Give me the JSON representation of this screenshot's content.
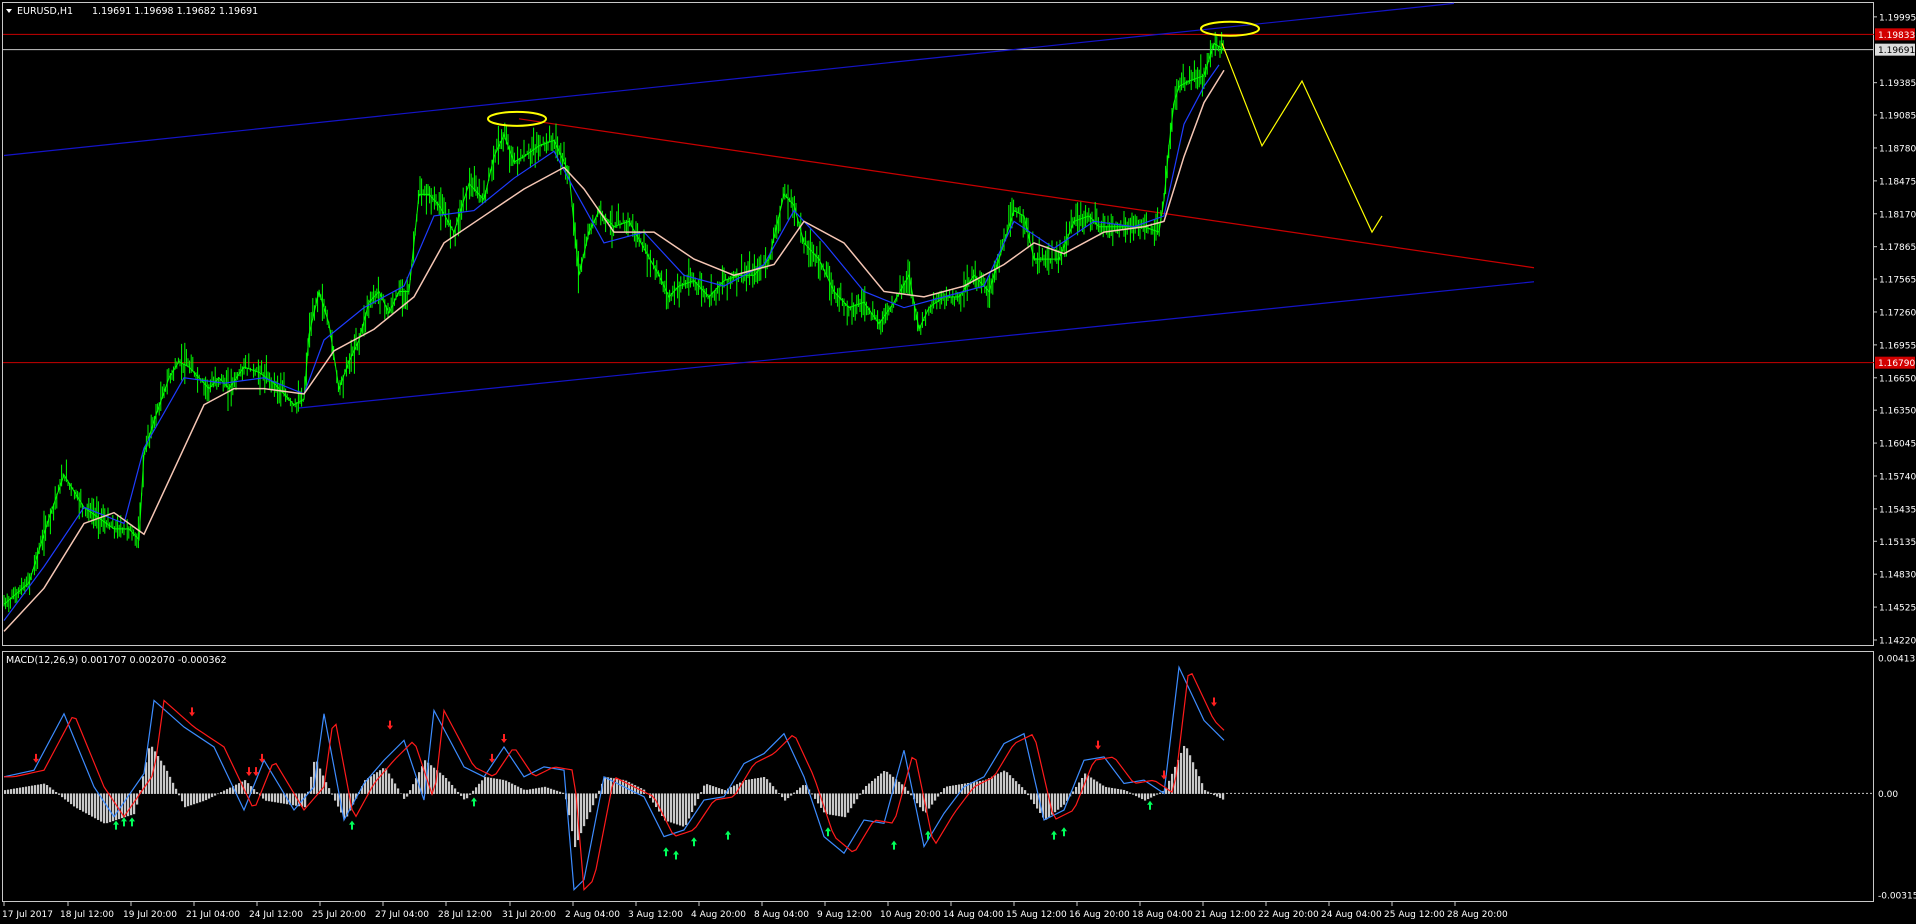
{
  "window": {
    "symbol_label": "EURUSD,H1",
    "ohlc_label": "1.19691 1.19698 1.19682 1.19691",
    "menu_icon": "triangle-down-icon"
  },
  "indicator": {
    "label": "MACD(12,26,9) 0.001707 0.002070 -0.000362"
  },
  "colors": {
    "background": "#000000",
    "frame": "#c8c8c8",
    "candles": "#00ff00",
    "ema_fast": "#1e3cff",
    "ema_slow": "#f5c6b4",
    "channel": "#1414c8",
    "resistance": "#c80000",
    "projection": "#ffff00",
    "macd_hist": "#c8c8c8",
    "macd_line": "#3c8cff",
    "signal_line": "#ff1a1a",
    "arrow_up": "#00ff5a",
    "arrow_down": "#ff2020",
    "price_tag_red": "#d20000"
  },
  "chart_data": {
    "type": "line",
    "title": "",
    "symbol": "EURUSD",
    "timeframe": "H1",
    "y_ticks": [
      "1.19995",
      "1.19385",
      "1.19085",
      "1.18780",
      "1.18475",
      "1.18170",
      "1.17865",
      "1.17565",
      "1.17260",
      "1.16955",
      "1.16650",
      "1.16350",
      "1.16045",
      "1.15740",
      "1.15435",
      "1.15135",
      "1.14830",
      "1.14525",
      "1.14220"
    ],
    "ylim": [
      1.1422,
      1.2004
    ],
    "x_labels": [
      "17 Jul 2017",
      "18 Jul 12:00",
      "19 Jul 20:00",
      "21 Jul 04:00",
      "24 Jul 12:00",
      "25 Jul 20:00",
      "27 Jul 04:00",
      "28 Jul 12:00",
      "31 Jul 20:00",
      "2 Aug 04:00",
      "3 Aug 12:00",
      "4 Aug 20:00",
      "8 Aug 04:00",
      "9 Aug 12:00",
      "10 Aug 20:00",
      "14 Aug 04:00",
      "15 Aug 12:00",
      "16 Aug 20:00",
      "18 Aug 04:00",
      "21 Aug 12:00",
      "22 Aug 20:00",
      "24 Aug 04:00",
      "25 Aug 12:00",
      "28 Aug 20:00"
    ],
    "series": [
      {
        "role": "price",
        "x": [
          0,
          25,
          45,
          60,
          80,
          95,
          110,
          125,
          135,
          140,
          150,
          165,
          175,
          185,
          195,
          205,
          215,
          225,
          240,
          255,
          270,
          290,
          300,
          305,
          315,
          325,
          335,
          345,
          355,
          365,
          375,
          385,
          395,
          405,
          415,
          425,
          435,
          450,
          465,
          480,
          490,
          500,
          510,
          520,
          535,
          550,
          565,
          575,
          585,
          595,
          610,
          625,
          640,
          655,
          665,
          675,
          690,
          705,
          720,
          735,
          750,
          765,
          780,
          790,
          800,
          815,
          830,
          845,
          860,
          875,
          890,
          905,
          915,
          925,
          940,
          955,
          970,
          985,
          1000,
          1010,
          1020,
          1030,
          1040,
          1055,
          1070,
          1085,
          1095,
          1110,
          1125,
          1140,
          1155,
          1160,
          1165,
          1170,
          1175,
          1185,
          1200,
          1210,
          1220
        ],
        "y": [
          1.1455,
          1.1475,
          1.1535,
          1.1575,
          1.1545,
          1.1535,
          1.1525,
          1.1525,
          1.1515,
          1.1595,
          1.1625,
          1.1665,
          1.168,
          1.1675,
          1.1665,
          1.1655,
          1.1665,
          1.1655,
          1.1675,
          1.167,
          1.166,
          1.164,
          1.1645,
          1.1705,
          1.1745,
          1.1715,
          1.1655,
          1.168,
          1.17,
          1.1735,
          1.1745,
          1.1725,
          1.1745,
          1.1745,
          1.1835,
          1.1835,
          1.1825,
          1.18,
          1.1845,
          1.183,
          1.187,
          1.189,
          1.1865,
          1.187,
          1.188,
          1.1885,
          1.1855,
          1.176,
          1.18,
          1.182,
          1.1805,
          1.181,
          1.1785,
          1.176,
          1.174,
          1.175,
          1.1755,
          1.174,
          1.1755,
          1.176,
          1.176,
          1.1775,
          1.1835,
          1.1825,
          1.179,
          1.1775,
          1.1745,
          1.173,
          1.1735,
          1.1715,
          1.1735,
          1.176,
          1.171,
          1.173,
          1.174,
          1.174,
          1.176,
          1.1745,
          1.179,
          1.182,
          1.1815,
          1.1775,
          1.1775,
          1.1775,
          1.181,
          1.1815,
          1.1805,
          1.1805,
          1.1805,
          1.1805,
          1.18,
          1.183,
          1.188,
          1.192,
          1.1935,
          1.194,
          1.1945,
          1.1975,
          1.1969
        ]
      },
      {
        "role": "fast moving average",
        "x": [
          0,
          40,
          80,
          120,
          140,
          180,
          220,
          260,
          300,
          320,
          360,
          400,
          430,
          470,
          510,
          550,
          570,
          600,
          640,
          680,
          720,
          760,
          790,
          820,
          860,
          900,
          940,
          980,
          1010,
          1050,
          1090,
          1130,
          1160,
          1180,
          1200,
          1215
        ],
        "y": [
          1.144,
          1.149,
          1.1545,
          1.153,
          1.16,
          1.1665,
          1.166,
          1.1665,
          1.165,
          1.17,
          1.173,
          1.175,
          1.1815,
          1.182,
          1.185,
          1.1875,
          1.184,
          1.179,
          1.18,
          1.176,
          1.175,
          1.177,
          1.182,
          1.179,
          1.1745,
          1.173,
          1.174,
          1.175,
          1.181,
          1.1785,
          1.181,
          1.1805,
          1.1815,
          1.19,
          1.1935,
          1.1955
        ]
      },
      {
        "role": "slow moving average",
        "x": [
          0,
          40,
          80,
          110,
          140,
          170,
          200,
          230,
          260,
          300,
          330,
          370,
          410,
          440,
          480,
          520,
          560,
          580,
          610,
          650,
          690,
          730,
          770,
          800,
          840,
          880,
          920,
          960,
          1000,
          1030,
          1060,
          1100,
          1140,
          1160,
          1180,
          1200,
          1220
        ],
        "y": [
          1.143,
          1.147,
          1.153,
          1.154,
          1.152,
          1.158,
          1.164,
          1.1655,
          1.1655,
          1.165,
          1.169,
          1.171,
          1.174,
          1.179,
          1.1815,
          1.184,
          1.186,
          1.184,
          1.18,
          1.18,
          1.1775,
          1.176,
          1.177,
          1.181,
          1.179,
          1.1745,
          1.174,
          1.175,
          1.177,
          1.179,
          1.178,
          1.18,
          1.1805,
          1.181,
          1.187,
          1.192,
          1.195
        ]
      }
    ],
    "horizontal_levels": [
      {
        "price": 1.19833,
        "label": "1.19833",
        "style": "red line + red tag"
      },
      {
        "price": 1.19691,
        "label": "1.19691",
        "style": "bid line + grey tag"
      },
      {
        "price": 1.1679,
        "label": "1.16790",
        "style": "red line + red tag"
      }
    ],
    "trendlines": [
      {
        "kind": "channel upper",
        "points": [
          [
            0,
            1.1871
          ],
          [
            1450,
            1.2012
          ]
        ]
      },
      {
        "kind": "channel lower",
        "points": [
          [
            295,
            1.1637
          ],
          [
            1530,
            1.1754
          ]
        ]
      },
      {
        "kind": "resistance",
        "points": [
          [
            515,
            1.1905
          ],
          [
            1530,
            1.1767
          ]
        ]
      }
    ],
    "highlights": [
      {
        "kind": "ellipse",
        "center": [
          513,
          1.1905
        ]
      },
      {
        "kind": "ellipse",
        "center": [
          1226,
          1.19885
        ]
      }
    ],
    "projection": {
      "x": [
        1218,
        1258,
        1298,
        1368,
        1378
      ],
      "y": [
        1.1975,
        1.188,
        1.194,
        1.18,
        1.1815
      ]
    },
    "macd": {
      "ylim": [
        -0.00315,
        0.00414
      ],
      "y_ticks": [
        "0.004137",
        "0.00",
        "-0.003151"
      ],
      "hist_x": [
        0,
        40,
        70,
        100,
        130,
        145,
        160,
        180,
        200,
        220,
        240,
        260,
        280,
        300,
        310,
        320,
        340,
        360,
        380,
        400,
        420,
        440,
        460,
        480,
        500,
        520,
        540,
        560,
        570,
        580,
        600,
        620,
        640,
        660,
        680,
        700,
        720,
        740,
        760,
        780,
        800,
        820,
        840,
        860,
        880,
        900,
        920,
        940,
        960,
        980,
        1000,
        1020,
        1040,
        1060,
        1080,
        1100,
        1120,
        1140,
        1160,
        1180,
        1200,
        1220
      ],
      "hist_y": [
        0.0001,
        0.0003,
        -0.0004,
        -0.0009,
        -0.0006,
        0.0015,
        0.0008,
        -0.0004,
        -0.0002,
        0.0001,
        0.0004,
        -0.0002,
        -0.0003,
        -0.0004,
        0.0011,
        0.0004,
        -0.0008,
        0.0004,
        0.0008,
        -0.0002,
        0.001,
        0.0005,
        -0.0002,
        0.0005,
        0.0004,
        0.0001,
        0.0002,
        0.0,
        -0.0016,
        -0.0009,
        0.0005,
        0.0004,
        0.0001,
        -0.0008,
        -0.001,
        0.0003,
        0.0001,
        0.0004,
        0.0005,
        -0.0002,
        0.0003,
        -0.0006,
        -0.0007,
        0.0002,
        0.0007,
        0.0002,
        -0.0006,
        0.0002,
        0.0003,
        0.0004,
        0.0007,
        0.0001,
        -0.0008,
        -0.0003,
        0.0006,
        0.0002,
        0.0001,
        -0.0002,
        0.0001,
        0.0015,
        0.0001,
        -0.0002
      ],
      "macd_x": [
        0,
        30,
        60,
        90,
        110,
        140,
        150,
        180,
        210,
        240,
        260,
        290,
        310,
        320,
        340,
        360,
        380,
        400,
        420,
        430,
        460,
        480,
        500,
        520,
        540,
        560,
        570,
        580,
        600,
        620,
        640,
        660,
        680,
        700,
        720,
        740,
        760,
        780,
        800,
        820,
        840,
        860,
        880,
        900,
        920,
        940,
        960,
        980,
        1000,
        1020,
        1040,
        1060,
        1080,
        1100,
        1120,
        1140,
        1160,
        1175,
        1200,
        1220
      ],
      "macd_y": [
        0.0005,
        0.0007,
        0.0024,
        0.0002,
        -0.0007,
        0.0006,
        0.0028,
        0.002,
        0.0014,
        -0.0005,
        0.001,
        -0.0005,
        0.0002,
        0.0024,
        -0.0008,
        0.0003,
        0.001,
        0.0016,
        -0.0002,
        0.0025,
        0.0008,
        0.0005,
        0.0014,
        0.0005,
        0.0008,
        0.0007,
        -0.0029,
        -0.0026,
        0.0005,
        0.0002,
        -0.0001,
        -0.0013,
        -0.0011,
        -0.0002,
        -0.0001,
        0.0009,
        0.0012,
        0.0018,
        0.0005,
        -0.0013,
        -0.0018,
        -0.0008,
        -0.0009,
        0.0013,
        -0.0016,
        -0.0006,
        0.0002,
        0.0005,
        0.0015,
        0.0018,
        -0.0008,
        -0.0005,
        0.001,
        0.0011,
        0.0003,
        0.0004,
        0.0,
        0.0038,
        0.0022,
        0.0016
      ]
    },
    "arrows_up": [
      [
        112,
        -0.0007
      ],
      [
        120,
        -0.0006
      ],
      [
        128,
        -0.0006
      ],
      [
        348,
        -0.0007
      ],
      [
        470,
        0.0
      ],
      [
        662,
        -0.0015
      ],
      [
        672,
        -0.0016
      ],
      [
        690,
        -0.0012
      ],
      [
        724,
        -0.001
      ],
      [
        824,
        -0.0009
      ],
      [
        890,
        -0.0013
      ],
      [
        924,
        -0.001
      ],
      [
        1050,
        -0.001
      ],
      [
        1060,
        -0.0009
      ],
      [
        1146,
        -0.0001
      ]
    ],
    "arrows_down": [
      [
        32,
        0.0008
      ],
      [
        188,
        0.0022
      ],
      [
        245,
        0.0004
      ],
      [
        252,
        0.0004
      ],
      [
        258,
        0.0008
      ],
      [
        386,
        0.0018
      ],
      [
        488,
        0.0008
      ],
      [
        500,
        0.0014
      ],
      [
        1094,
        0.0012
      ],
      [
        1160,
        0.0003
      ],
      [
        1210,
        0.0025
      ]
    ]
  }
}
